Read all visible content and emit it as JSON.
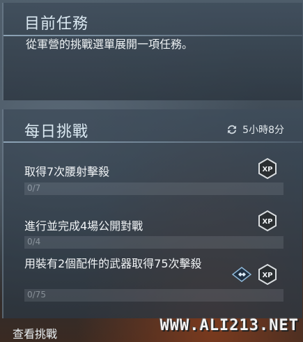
{
  "current_task": {
    "title": "目前任務",
    "description": "從軍營的挑戰選單展開一項任務。"
  },
  "daily": {
    "title": "每日挑戰",
    "timer": "5小時8分",
    "challenges": [
      {
        "text": "取得7次腰射擊殺",
        "progress_label": "0/7",
        "progress": 0
      },
      {
        "text": "進行並完成4場公開對戰",
        "progress_label": "0/4",
        "progress": 0
      },
      {
        "text": "用裝有2個配件的武器取得75次擊殺",
        "progress_label": "0/75",
        "progress": 0
      }
    ]
  },
  "footer": {
    "view_challenges": "查看挑戰"
  },
  "watermark": "WWW.ALI213.NET",
  "icons": {
    "refresh": "refresh-icon",
    "xp": "xp-icon",
    "attachment": "attachment-icon"
  }
}
